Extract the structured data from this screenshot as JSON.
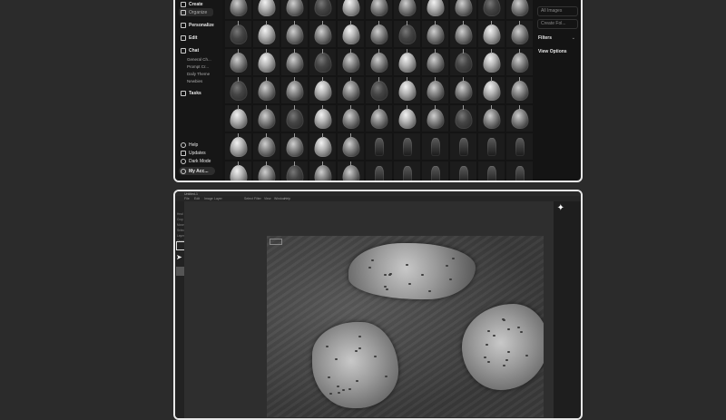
{
  "top_window": {
    "sidebar": {
      "create": "Create",
      "organize": "Organize",
      "personalize": "Personalize",
      "edit": "Edit",
      "chat": "Chat",
      "chat_items": [
        "General Ch...",
        "Prompt Cr...",
        "Daily Theme",
        "Newbies"
      ],
      "tasks": "Tasks",
      "help": "Help",
      "updates": "Updates",
      "dark_mode": "Dark Mode",
      "account": "My Acc..."
    },
    "right_panel": {
      "all_images": "All Images",
      "create_folder": "Create Fol...",
      "filters": "Filters",
      "view_options": "View Options"
    }
  },
  "bottom_window": {
    "title": "Untitled-1",
    "menu": [
      "File",
      "Edit",
      "Image",
      "Layer",
      "",
      "",
      "Select",
      "Filter",
      "View",
      "Window",
      "Help"
    ],
    "side_list": [
      "Heal",
      "Crop",
      "Move",
      "Select",
      "Layer",
      "Overlay"
    ]
  }
}
